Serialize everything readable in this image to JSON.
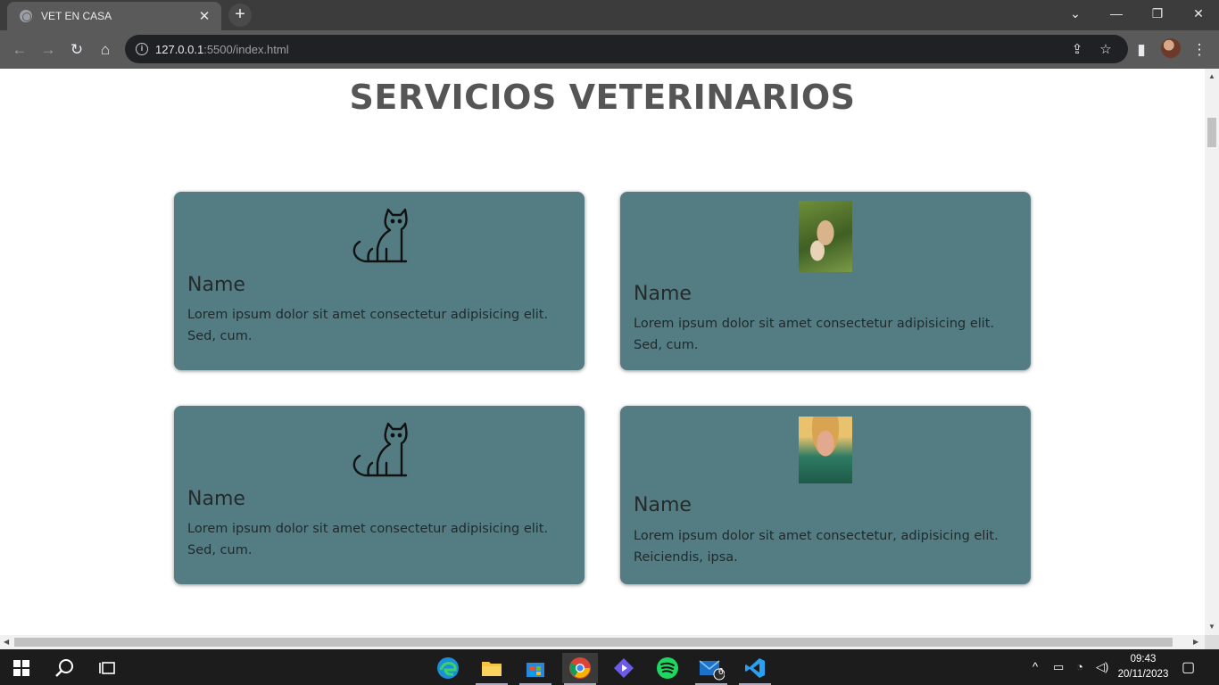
{
  "browser": {
    "tab_title": "VET EN CASA",
    "new_tab": "+",
    "url_host": "127.0.0.1",
    "url_rest": ":5500/index.html"
  },
  "page": {
    "title": "SERVICIOS VETERINARIOS",
    "cards": [
      {
        "name": "Name",
        "description": "Lorem ipsum dolor sit amet consectetur adipisicing elit. Sed, cum.",
        "image": "cat-icon"
      },
      {
        "name": "Name",
        "description": "Lorem ipsum dolor sit amet consectetur adipisicing elit. Sed, cum.",
        "image": "dog-photo"
      },
      {
        "name": "Name",
        "description": "Lorem ipsum dolor sit amet consectetur adipisicing elit. Sed, cum.",
        "image": "cat-icon"
      },
      {
        "name": "Name",
        "description": "Lorem ipsum dolor sit amet consectetur, adipisicing elit. Reiciendis, ipsa.",
        "image": "woman-photo"
      }
    ],
    "card_color": "#547c83"
  },
  "taskbar": {
    "apps": [
      "start-icon",
      "search-icon",
      "task-view-icon",
      "edge-icon",
      "file-explorer-icon",
      "microsoft-store-icon",
      "chrome-icon",
      "app-icon",
      "spotify-icon",
      "mail-icon",
      "vscode-icon"
    ],
    "mail_badge": "6",
    "time": "09:43",
    "date": "20/11/2023"
  }
}
